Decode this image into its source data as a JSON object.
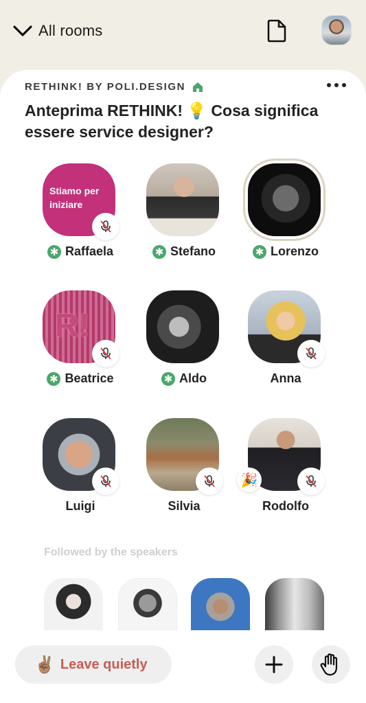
{
  "topbar": {
    "back_label": "All rooms"
  },
  "room": {
    "club_name": "RETHINK! BY POLI.DESIGN",
    "title": "Anteprima RETHINK! 💡 Cosa significa essere service designer?"
  },
  "speakers": [
    {
      "name": "Raffaela",
      "moderator": true,
      "muted": true,
      "avatar_text": "Stiamo per iniziare"
    },
    {
      "name": "Stefano",
      "moderator": true,
      "muted": false
    },
    {
      "name": "Lorenzo",
      "moderator": true,
      "muted": false,
      "speaking": true
    },
    {
      "name": "Beatrice",
      "moderator": true,
      "muted": true,
      "avatar_text": "R!"
    },
    {
      "name": "Aldo",
      "moderator": true,
      "muted": false
    },
    {
      "name": "Anna",
      "moderator": false,
      "muted": true
    },
    {
      "name": "Luigi",
      "moderator": false,
      "muted": true
    },
    {
      "name": "Silvia",
      "moderator": false,
      "muted": true
    },
    {
      "name": "Rodolfo",
      "moderator": false,
      "muted": true,
      "new_user": true
    }
  ],
  "followed_section": {
    "label": "Followed by the speakers"
  },
  "bottombar": {
    "leave_emoji": "✌🏽",
    "leave_label": "Leave quietly"
  },
  "icons": {
    "back": "chevron-down-icon",
    "doc": "document-icon",
    "house": "house-icon",
    "more": "more-dots-icon",
    "mute": "mic-muted-icon",
    "add": "plus-icon",
    "hand": "raise-hand-icon"
  },
  "colors": {
    "moderator_badge": "#4aa76b",
    "leave_text": "#c95a52",
    "background": "#f1efe5"
  }
}
